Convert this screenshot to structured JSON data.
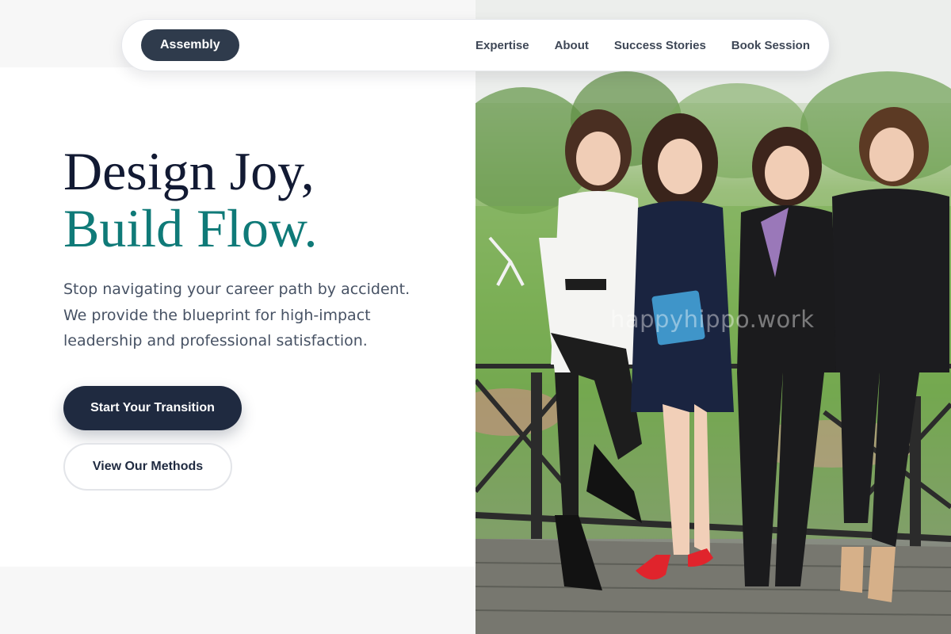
{
  "nav": {
    "brand": "Assembly",
    "links": [
      "Expertise",
      "About",
      "Success Stories",
      "Book Session"
    ]
  },
  "hero": {
    "title_line1": "Design Joy,",
    "title_line2": "Build Flow.",
    "subtitle_lines": [
      "Stop navigating your career path by accident.",
      "We provide the blueprint for high-impact",
      "leadership and professional satisfaction."
    ],
    "primary_cta": "Start Your Transition",
    "secondary_cta": "View Our Methods"
  },
  "photo": {
    "watermark": "happyhippo.work"
  },
  "colors": {
    "navy": "#1f2a40",
    "brand_pill": "#2f3b4c",
    "accent_teal": "#0f7a78",
    "heading_dark": "#121a33",
    "body_text": "#475264"
  }
}
